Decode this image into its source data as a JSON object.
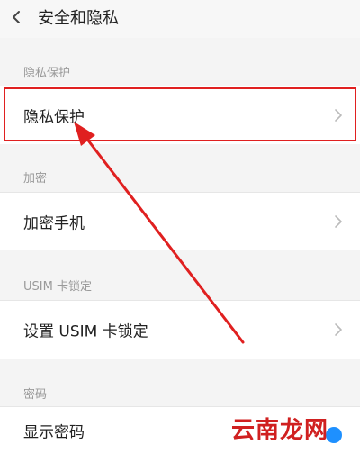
{
  "header": {
    "title": "安全和隐私"
  },
  "sections": [
    {
      "label": "隐私保护",
      "row_label": "隐私保护"
    },
    {
      "label": "加密",
      "row_label": "加密手机"
    },
    {
      "label": "USIM 卡锁定",
      "row_label": "设置 USIM 卡锁定"
    },
    {
      "label": "密码",
      "row_label": "显示密码"
    }
  ],
  "watermark": {
    "text": "云南龙网"
  },
  "colors": {
    "highlight": "#e02020",
    "toggle": "#1e90ff"
  },
  "icons": [
    "back-arrow-icon",
    "chevron-right-icon"
  ]
}
